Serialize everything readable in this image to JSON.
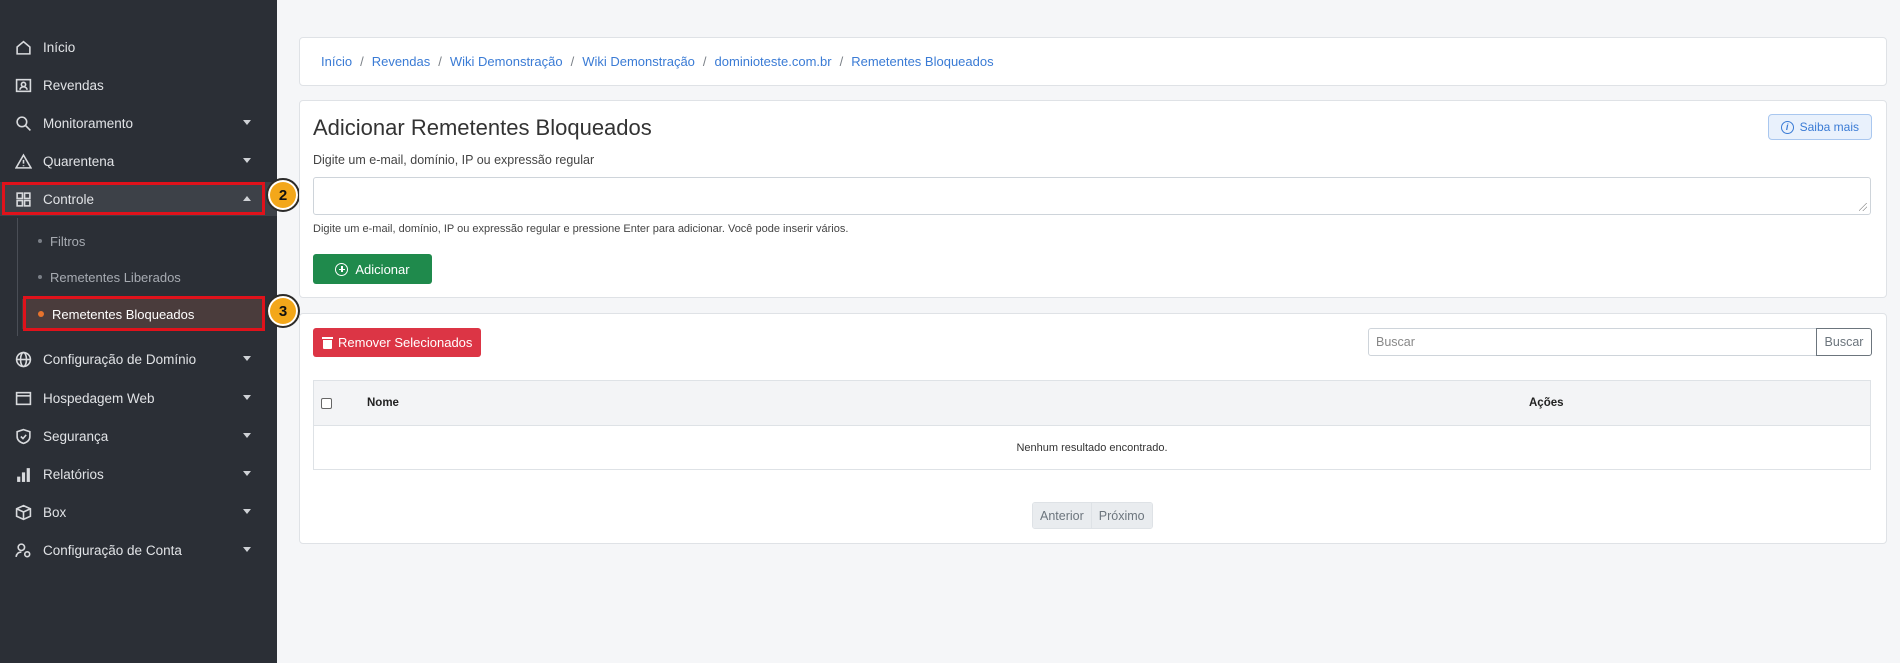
{
  "sidebar": {
    "items": [
      {
        "label": "Início",
        "icon": "home-icon"
      },
      {
        "label": "Revendas",
        "icon": "user-card-icon"
      },
      {
        "label": "Monitoramento",
        "icon": "search-icon"
      },
      {
        "label": "Quarentena",
        "icon": "warning-icon"
      },
      {
        "label": "Controle",
        "icon": "grid-icon"
      },
      {
        "label": "Configuração de Domínio",
        "icon": "globe-icon"
      },
      {
        "label": "Hospedagem Web",
        "icon": "window-icon"
      },
      {
        "label": "Segurança",
        "icon": "shield-icon"
      },
      {
        "label": "Relatórios",
        "icon": "bar-chart-icon"
      },
      {
        "label": "Box",
        "icon": "box-icon"
      },
      {
        "label": "Configuração de Conta",
        "icon": "user-gear-icon"
      }
    ],
    "subitems": [
      {
        "label": "Filtros"
      },
      {
        "label": "Remetentes Liberados"
      },
      {
        "label": "Remetentes Bloqueados"
      }
    ],
    "accent_color": "#e8732d"
  },
  "annotations": {
    "step2": "2",
    "step3": "3",
    "highlight_color": "#e0121b",
    "badge_color": "#f3a71a"
  },
  "breadcrumb": [
    "Início",
    "Revendas",
    "Wiki Demonstração",
    "Wiki Demonstração",
    "dominioteste.com.br",
    "Remetentes Bloqueados"
  ],
  "add_card": {
    "title": "Adicionar Remetentes Bloqueados",
    "subtitle": "Digite um e-mail, domínio, IP ou expressão regular",
    "textarea_value": "",
    "help": "Digite um e-mail, domínio, IP ou expressão regular e pressione Enter para adicionar. Você pode inserir vários.",
    "add_label": "Adicionar",
    "saiba_label": "Saiba mais"
  },
  "list_card": {
    "remove_label": "Remover Selecionados",
    "search_placeholder": "Buscar",
    "search_button": "Buscar",
    "columns": [
      "Nome",
      "Ações"
    ],
    "empty_text": "Nenhum resultado encontrado.",
    "pager": {
      "prev": "Anterior",
      "next": "Próximo"
    }
  }
}
